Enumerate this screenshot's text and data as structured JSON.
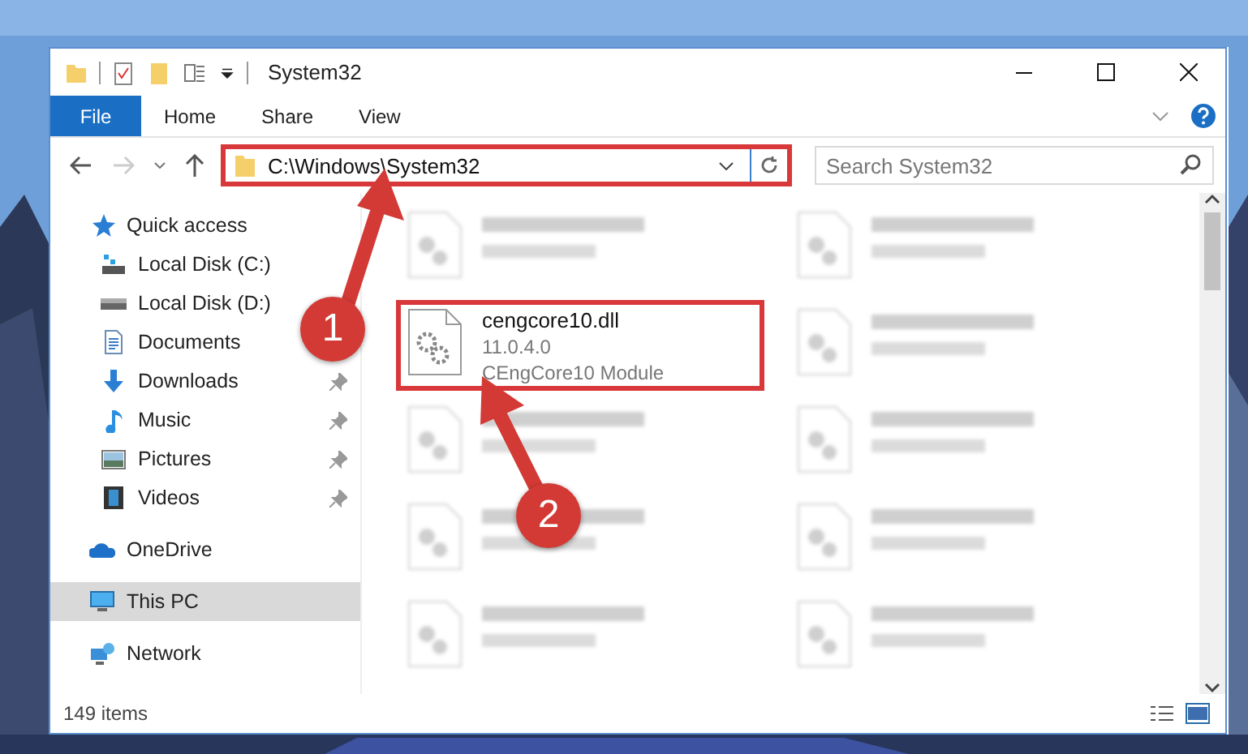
{
  "window": {
    "title": "System32"
  },
  "ribbon": {
    "file_button": "File",
    "tabs": [
      {
        "label": "Home",
        "selected": false
      },
      {
        "label": "Share",
        "selected": false
      },
      {
        "label": "View",
        "selected": false
      }
    ]
  },
  "address": {
    "path": "C:\\Windows\\System32",
    "highlighted": true
  },
  "search": {
    "placeholder": "Search System32"
  },
  "sidebar": {
    "items": [
      {
        "label": "Quick access",
        "kind": "star",
        "selected": false,
        "children": [
          {
            "label": "Local Disk (C:)",
            "kind": "system-drive",
            "pinned": false,
            "selected": false
          },
          {
            "label": "Local Disk (D:)",
            "kind": "drive",
            "pinned": false,
            "selected": false
          },
          {
            "label": "Documents",
            "kind": "documents",
            "pinned": false,
            "selected": false
          },
          {
            "label": "Downloads",
            "kind": "downloads",
            "pinned": true,
            "selected": false
          },
          {
            "label": "Music",
            "kind": "music",
            "pinned": true,
            "selected": false
          },
          {
            "label": "Pictures",
            "kind": "pictures",
            "pinned": true,
            "selected": false
          },
          {
            "label": "Videos",
            "kind": "videos",
            "pinned": true,
            "selected": false
          }
        ]
      },
      {
        "label": "OneDrive",
        "kind": "cloud",
        "selected": false
      },
      {
        "label": "This PC",
        "kind": "pc",
        "selected": true
      },
      {
        "label": "Network",
        "kind": "network",
        "selected": false
      }
    ]
  },
  "files": [
    {
      "kind": "blurred"
    },
    {
      "kind": "blurred"
    },
    {
      "kind": "file",
      "name": "cengcore10.dll",
      "details": [
        "11.0.4.0",
        "CEngCore10 Module"
      ],
      "highlighted": true
    },
    {
      "kind": "blurred"
    },
    {
      "kind": "blurred"
    },
    {
      "kind": "blurred"
    },
    {
      "kind": "blurred"
    },
    {
      "kind": "blurred"
    },
    {
      "kind": "blurred"
    },
    {
      "kind": "blurred"
    }
  ],
  "status_bar": {
    "item_count": "149 items"
  },
  "annotations": [
    {
      "number": "1"
    },
    {
      "number": "2"
    }
  ]
}
